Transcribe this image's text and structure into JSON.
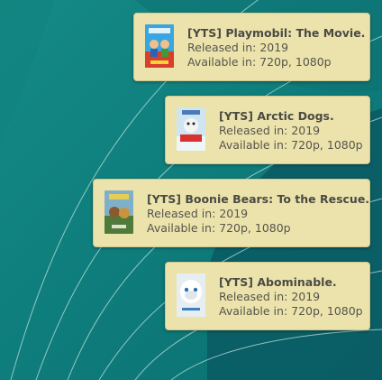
{
  "notifications": [
    {
      "title": "[YTS] Playmobil: The Movie.",
      "released": "Released in: 2019",
      "available": "Available in: 720p, 1080p",
      "poster_icon": "poster-playmobil"
    },
    {
      "title": "[YTS] Arctic Dogs.",
      "released": "Released in: 2019",
      "available": "Available in: 720p, 1080p",
      "poster_icon": "poster-arctic-dogs"
    },
    {
      "title": "[YTS] Boonie Bears: To the Rescue.",
      "released": "Released in: 2019",
      "available": "Available in: 720p, 1080p",
      "poster_icon": "poster-boonie-bears"
    },
    {
      "title": "[YTS] Abominable.",
      "released": "Released in: 2019",
      "available": "Available in: 720p, 1080p",
      "poster_icon": "poster-abominable"
    }
  ],
  "colors": {
    "notification_bg": "#ece3ac",
    "wallpaper_teal": "#0f7a78",
    "wallpaper_dark": "#0b5560"
  }
}
